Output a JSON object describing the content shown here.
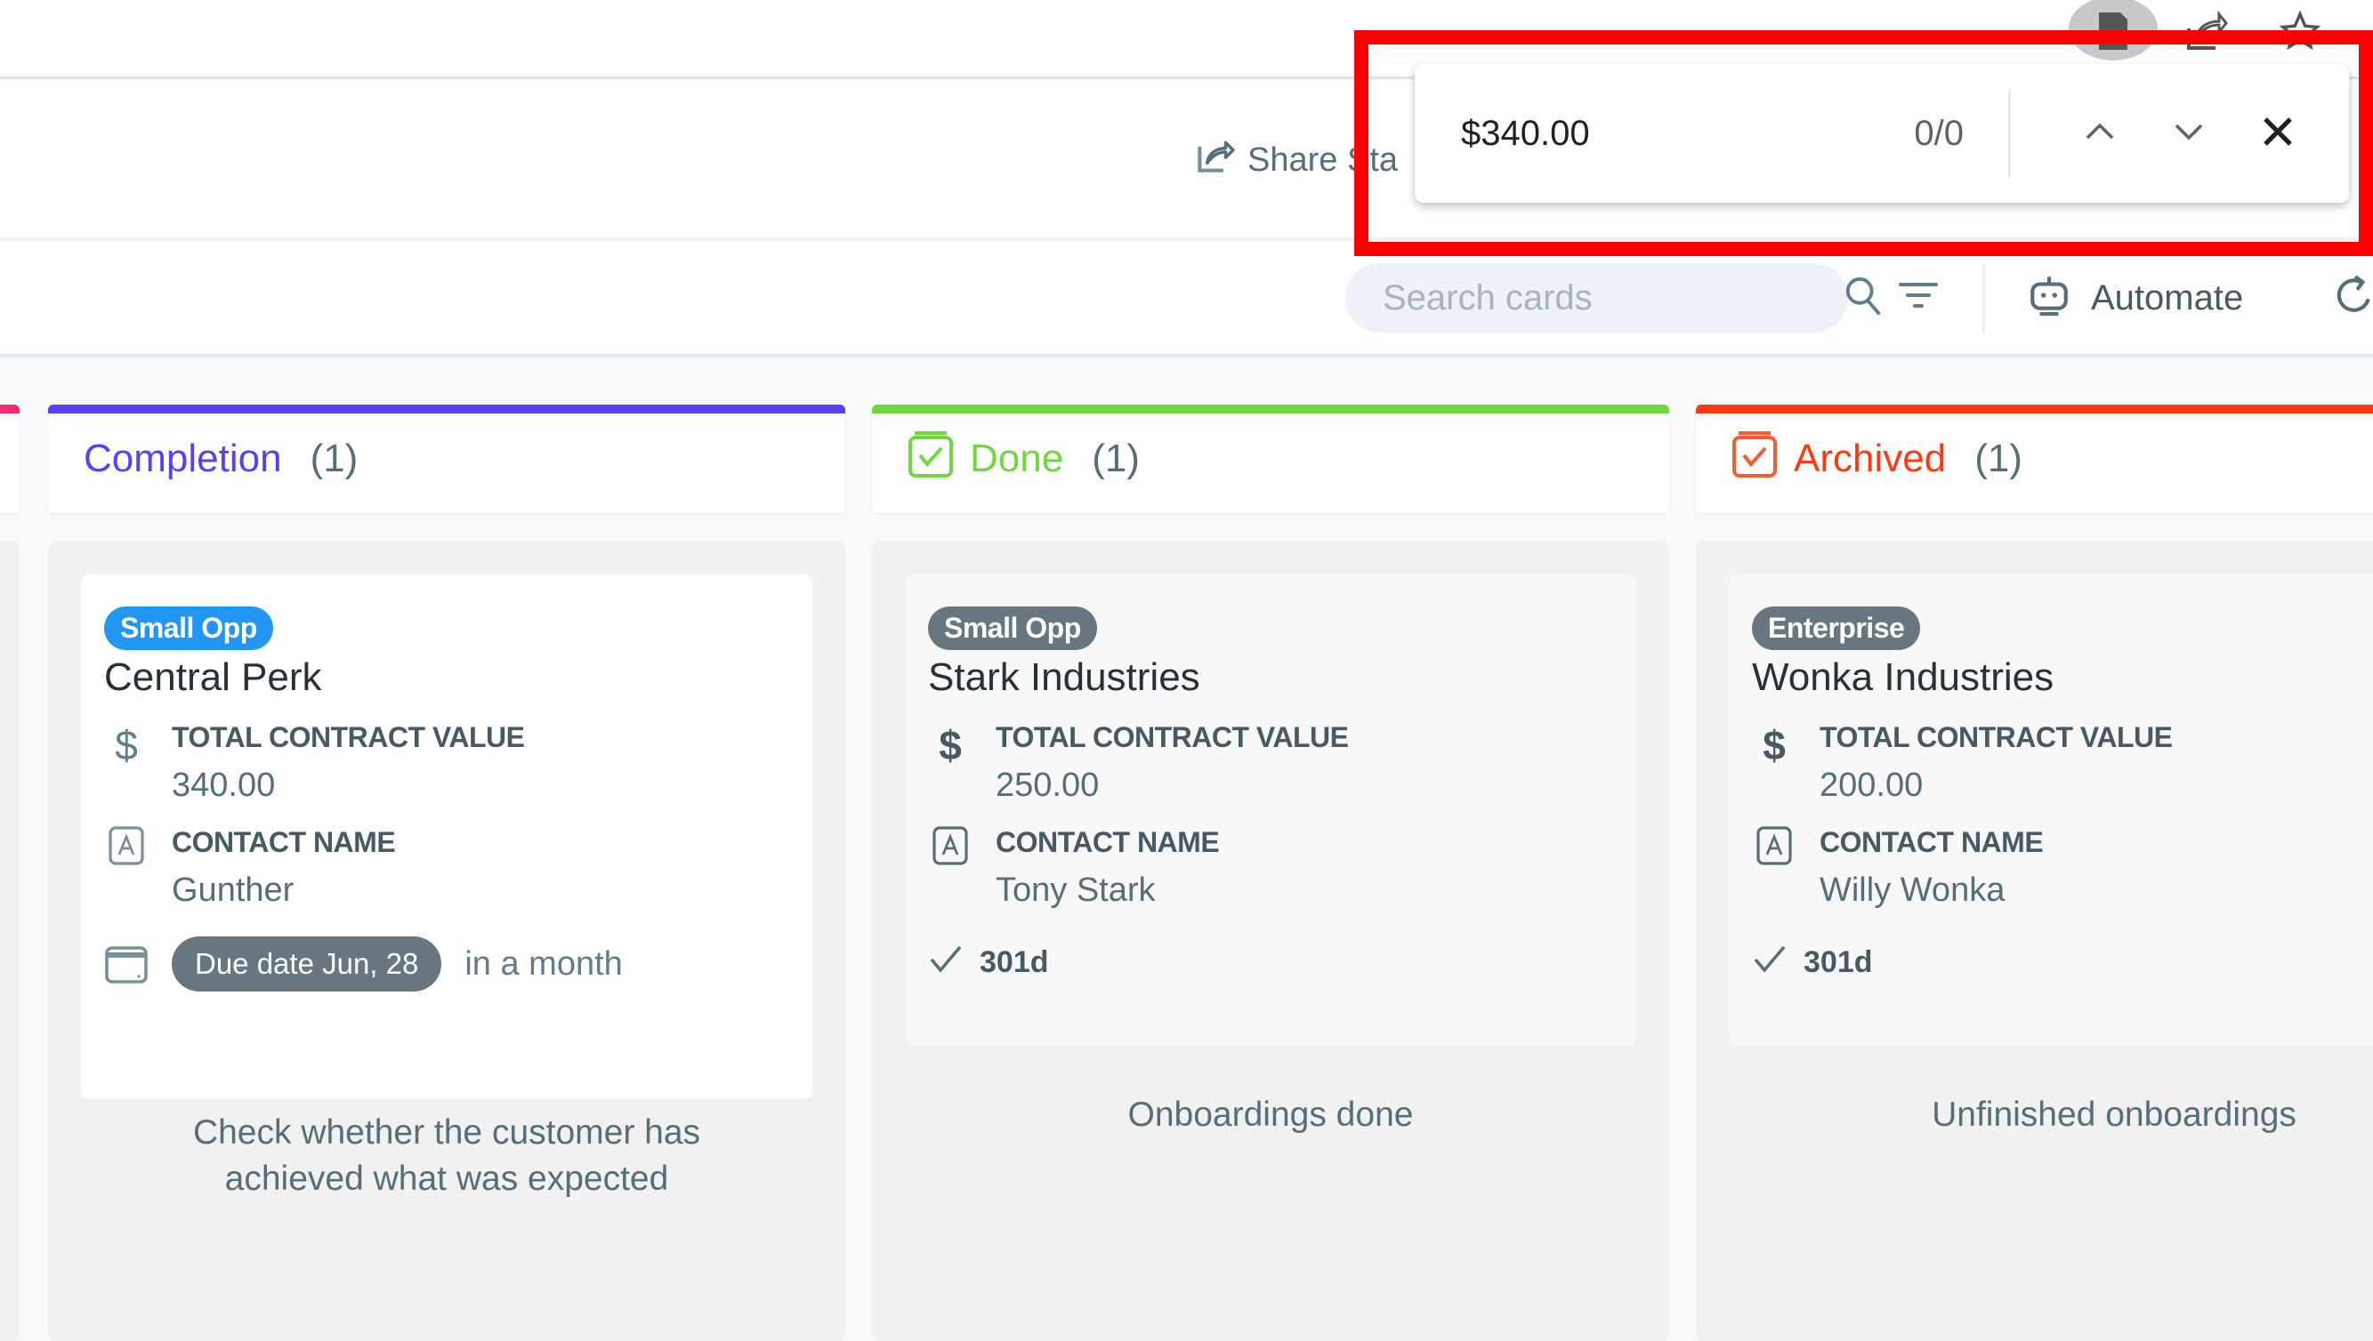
{
  "browser": {
    "icons": [
      "extension-icon",
      "share-page-icon",
      "bookmark-star-icon"
    ]
  },
  "header": {
    "share_label": "Share Sta"
  },
  "toolbar": {
    "search_placeholder": "Search cards",
    "search_value": "",
    "automate_label": "Automate"
  },
  "find_bar": {
    "query": "$340.00",
    "match_count": "0/0"
  },
  "colors": {
    "completion": "#5c3ff3",
    "done": "#6dd93c",
    "archived": "#fa3a10",
    "prev_column": "#ef2a72",
    "tag_blue": "#2196f3",
    "tag_gray": "#68777f",
    "highlight_red": "#ff0000"
  },
  "columns": [
    {
      "name": "Completion",
      "count": "(1)",
      "description": "Check whether the customer has achieved what was expected",
      "card": {
        "tag": "Small Opp",
        "title": "Central Perk",
        "tcv_label": "TOTAL CONTRACT VALUE",
        "tcv_value": "340.00",
        "contact_label": "CONTACT NAME",
        "contact_value": "Gunther",
        "due_label": "Due date Jun, 28",
        "due_relative": "in a month"
      }
    },
    {
      "name": "Done",
      "count": "(1)",
      "description": "Onboardings done",
      "card": {
        "tag": "Small Opp",
        "title": "Stark Industries",
        "tcv_label": "TOTAL CONTRACT VALUE",
        "tcv_value": "250.00",
        "contact_label": "CONTACT NAME",
        "contact_value": "Tony Stark",
        "age": "301d"
      }
    },
    {
      "name": "Archived",
      "count": "(1)",
      "description": "Unfinished onboardings",
      "card": {
        "tag": "Enterprise",
        "title": "Wonka Industries",
        "tcv_label": "TOTAL CONTRACT VALUE",
        "tcv_value": "200.00",
        "contact_label": "CONTACT NAME",
        "contact_value": "Willy Wonka",
        "age": "301d"
      }
    }
  ]
}
